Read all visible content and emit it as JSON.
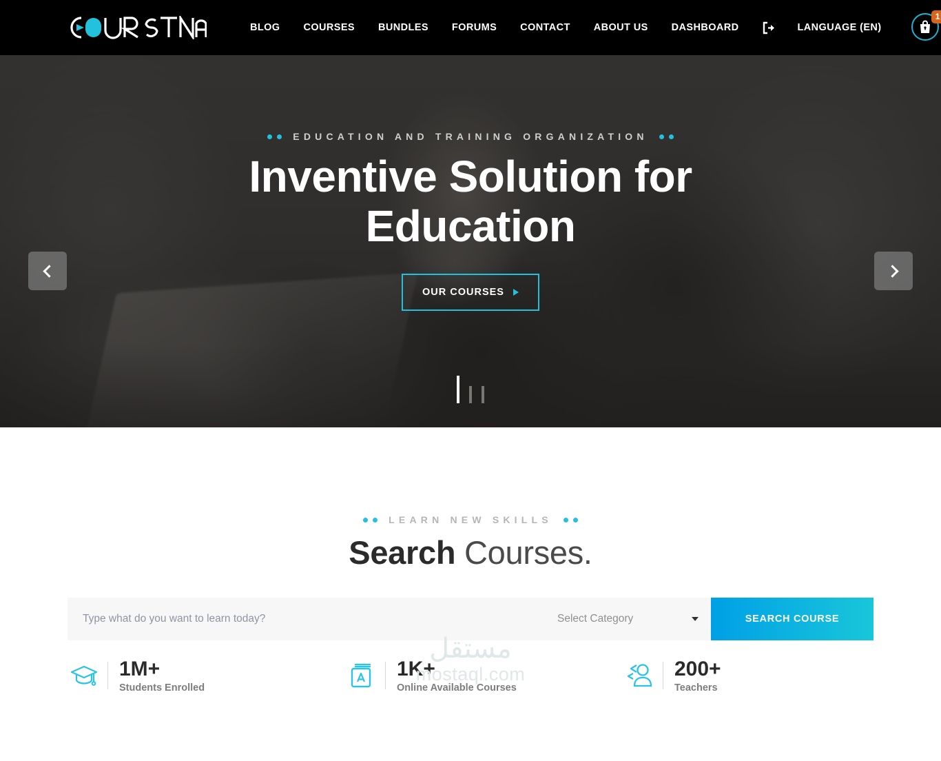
{
  "header": {
    "logo_text": "COURSTNA",
    "nav_items": [
      {
        "label": "BLOG"
      },
      {
        "label": "COURSES"
      },
      {
        "label": "BUNDLES"
      },
      {
        "label": "FORUMS"
      },
      {
        "label": "CONTACT"
      },
      {
        "label": "ABOUT US"
      },
      {
        "label": "DASHBOARD"
      }
    ],
    "logout_icon": "logout-icon",
    "language_label": "LANGUAGE (EN)",
    "cart_icon": "shopping-bag-icon",
    "cart_count": "1",
    "accent_color": "#23c1dd",
    "badge_color": "#d9651a",
    "background_color": "#000000"
  },
  "hero": {
    "eyebrow": "EDUCATION AND TRAINING ORGANIZATION",
    "title": "Inventive Solution for Education",
    "cta_label": "OUR COURSES",
    "prev_icon": "chevron-left-icon",
    "next_icon": "chevron-right-icon",
    "slides": [
      {
        "active": true
      },
      {
        "active": false
      },
      {
        "active": false
      }
    ]
  },
  "search_section": {
    "eyebrow": "LEARN NEW SKILLS",
    "title_bold": "Search",
    "title_rest": " Courses.",
    "search_placeholder": "Type what do you want to learn today?",
    "search_value": "",
    "category_selected": "Select Category",
    "search_button_label": "SEARCH COURSE",
    "button_gradient_from": "#00a0e6",
    "button_gradient_to": "#19c6d9"
  },
  "stats": [
    {
      "icon": "graduation-cap-icon",
      "number": "1M+",
      "label": "Students Enrolled"
    },
    {
      "icon": "book-icon",
      "number": "1K+",
      "label": "Online Available Courses"
    },
    {
      "icon": "teacher-icon",
      "number": "200+",
      "label": "Teachers"
    }
  ],
  "watermark": {
    "arabic": "مستقل",
    "latin": "mostaql.com"
  }
}
